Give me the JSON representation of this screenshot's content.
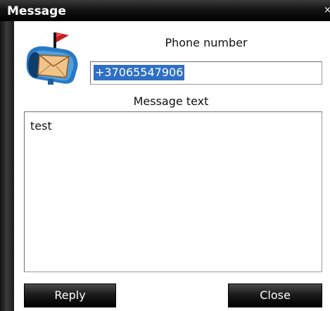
{
  "window": {
    "title": "Message",
    "close_glyph": "×"
  },
  "form": {
    "phone_label": "Phone number",
    "phone_value": "+37065547906",
    "message_label": "Message text",
    "message_value": "test"
  },
  "buttons": {
    "reply_label": "Reply",
    "close_label": "Close"
  },
  "icons": {
    "app_icon": "mailbox-icon"
  },
  "colors": {
    "titlebar": "#000000",
    "selection": "#2f6fc6",
    "button_bg": "#1c1c1c",
    "button_text": "#ffffff"
  }
}
